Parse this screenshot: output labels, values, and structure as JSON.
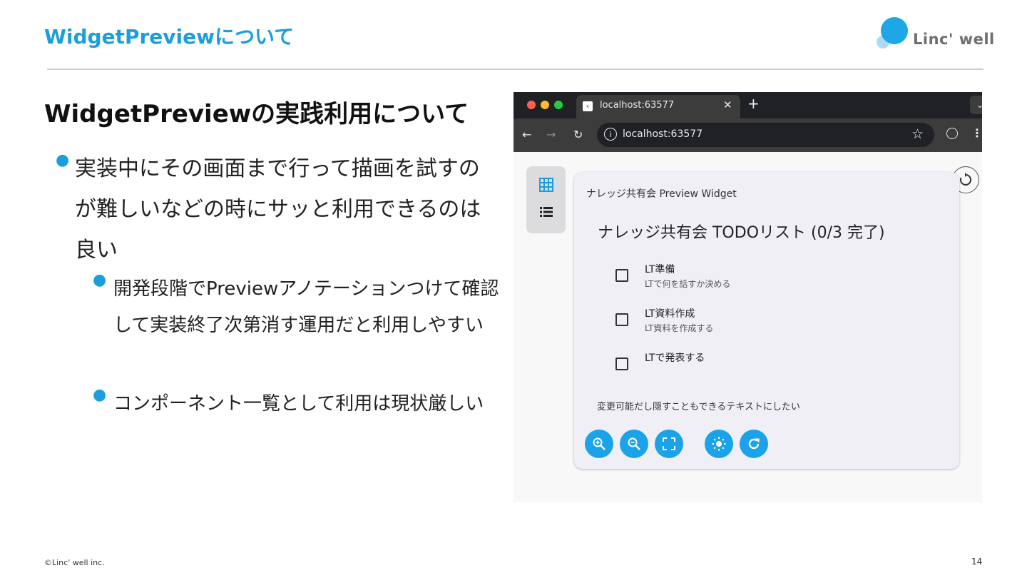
{
  "slide": {
    "title": "WidgetPreviewについて",
    "logo_text": "Linc' well",
    "heading": "WidgetPreviewの実践利用について",
    "bullets": [
      {
        "text": "実装中にその画面まで行って描画を試すのが難しいなどの時にサッと利用できるのは良い"
      },
      {
        "text": "開発段階でPreviewアノテーションつけて確認して実装終了次第消す運用だと利用しやすい"
      },
      {
        "text": "コンポーネント一覧として利用は現状厳しい"
      }
    ],
    "footer_left": "©Linc' well inc.",
    "page_number": "14"
  },
  "browser": {
    "tab_title": "localhost:63577",
    "url": "localhost:63577",
    "preview": {
      "caption": "ナレッジ共有会 Preview Widget",
      "heading": "ナレッジ共有会 TODOリスト (0/3 完了)",
      "todos": [
        {
          "title": "LT準備",
          "subtitle": "LTで何を話すか決める",
          "checked": false
        },
        {
          "title": "LT資料作成",
          "subtitle": "LT資料を作成する",
          "checked": false
        },
        {
          "title": "LTで発表する",
          "subtitle": "",
          "checked": false
        }
      ],
      "note": "変更可能だし隠すこともできるテキストにしたい",
      "toolbar_icons": [
        "zoom-in-icon",
        "zoom-out-icon",
        "fit-screen-icon",
        "brightness-icon",
        "refresh-icon"
      ]
    }
  },
  "colors": {
    "accent": "#1a9fdc",
    "fab": "#1aa3e8",
    "card_bg": "#f0eff6"
  }
}
